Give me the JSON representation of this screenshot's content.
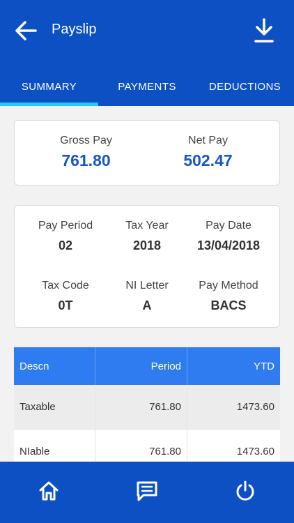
{
  "header": {
    "title": "Payslip",
    "back_icon": "arrow-left-icon",
    "download_icon": "download-icon",
    "colors": {
      "primary": "#0d50c4",
      "tab_indicator": "#29c8f0"
    }
  },
  "tabs": [
    {
      "label": "SUMMARY",
      "active": true
    },
    {
      "label": "PAYMENTS",
      "active": false
    },
    {
      "label": "DEDUCTIONS",
      "active": false
    }
  ],
  "summary": {
    "gross_pay_label": "Gross Pay",
    "gross_pay": "761.80",
    "net_pay_label": "Net Pay",
    "net_pay": "502.47",
    "value_color": "#1457c6"
  },
  "details": {
    "pay_period_label": "Pay Period",
    "pay_period": "02",
    "tax_year_label": "Tax Year",
    "tax_year": "2018",
    "pay_date_label": "Pay Date",
    "pay_date": "13/04/2018",
    "tax_code_label": "Tax Code",
    "tax_code": "0T",
    "ni_letter_label": "NI Letter",
    "ni_letter": "A",
    "pay_method_label": "Pay Method",
    "pay_method": "BACS"
  },
  "table": {
    "header_color": "#2f7cf0",
    "columns": [
      "Descn",
      "Period",
      "YTD"
    ],
    "rows": [
      {
        "descn": "Taxable",
        "period": "761.80",
        "ytd": "1473.60"
      },
      {
        "descn": "NIable",
        "period": "761.80",
        "ytd": "1473.60"
      }
    ]
  },
  "bottom_nav": {
    "items": [
      {
        "icon": "home-icon"
      },
      {
        "icon": "message-icon"
      },
      {
        "icon": "power-icon"
      }
    ]
  }
}
